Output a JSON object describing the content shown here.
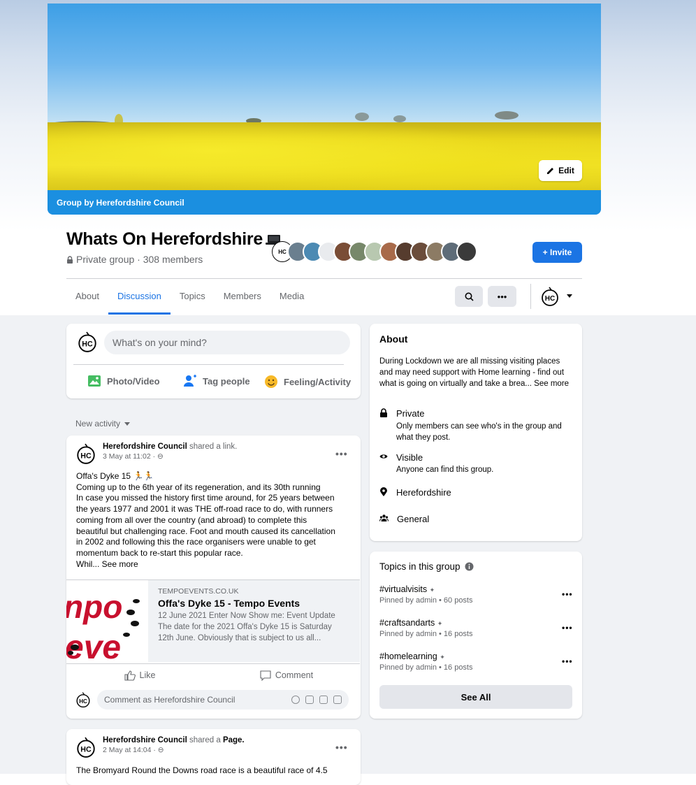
{
  "cover": {
    "owner_label": "Group by Herefordshire Council",
    "edit_label": "Edit"
  },
  "group": {
    "title": "Whats On Herefordshire",
    "meta": "Private group · 308 members",
    "invite_label": "+ Invite",
    "member_avatar_colors": [
      "#ffffff",
      "#6a7f8f",
      "#4c8ab3",
      "#e9ebee",
      "#7a4d36",
      "#77886a",
      "#b8c8b0",
      "#a86a4a",
      "#563c2e",
      "#6b4d3b",
      "#8c7b64",
      "#5e6c78",
      "#3a3a3a"
    ]
  },
  "tabs": [
    "About",
    "Discussion",
    "Topics",
    "Members",
    "Media"
  ],
  "active_tab": "Discussion",
  "composer": {
    "placeholder": "What's on your mind?",
    "photo_label": "Photo/Video",
    "tag_label": "Tag people",
    "feeling_label": "Feeling/Activity"
  },
  "feed": {
    "sort_label": "New activity"
  },
  "post1": {
    "author": "Herefordshire Council",
    "action": " shared a link.",
    "time": "3 May at 11:02 · ",
    "body_lines": [
      "Offa's Dyke 15 🏃🏃",
      "Coming up to the 6th year of its regeneration, and its 30th running",
      "In case you missed the history first time around, for 25 years between",
      "the years 1977 and 2001 it was THE off-road race to do, with runners",
      "coming from all over the country (and abroad) to complete this",
      "beautiful but challenging race. Foot and mouth caused its cancellation",
      "in 2002 and following this the race organisers were unable to get",
      "momentum back to re-start this popular race.",
      "Whil... See more"
    ],
    "link": {
      "domain": "TEMPOEVENTS.CO.UK",
      "title": "Offa's Dyke 15 - Tempo Events",
      "desc_line1": "12 June 2021 Enter Now Show me: Event Update",
      "desc_line2": "The date for the 2021 Offa's Dyke 15 is Saturday",
      "desc_line3": "12th June. Obviously that is subject to us all..."
    },
    "like_label": "Like",
    "comment_label": "Comment",
    "comment_placeholder": "Comment as Herefordshire Council"
  },
  "post2": {
    "author": "Herefordshire Council",
    "action_pre": " shared a ",
    "action_obj": "Page.",
    "time": "2 May at 14:04 · ",
    "body": "The Bromyard Round the Downs road race is a beautiful race of 4.5"
  },
  "about": {
    "title": "About",
    "description": "During Lockdown we are all missing visiting places and may need support with Home learning - find out what is going on virtually and take a brea... See more",
    "private_label": "Private",
    "private_sub": "Only members can see who's in the group and what they post.",
    "visible_label": "Visible",
    "visible_sub": "Anyone can find this group.",
    "location": "Herefordshire",
    "category": "General"
  },
  "topics": {
    "title": "Topics in this group",
    "items": [
      {
        "name": "#virtualvisits",
        "sub": "Pinned by admin • 60 posts"
      },
      {
        "name": "#craftsandarts",
        "sub": "Pinned by admin • 16 posts"
      },
      {
        "name": "#homelearning",
        "sub": "Pinned by admin • 16 posts"
      }
    ],
    "see_all_label": "See All"
  },
  "logo_text": "HC",
  "colors": {
    "accent": "#1b74e4",
    "cover_bar": "#1b8fe0",
    "feed_bg": "#f0f2f5"
  }
}
